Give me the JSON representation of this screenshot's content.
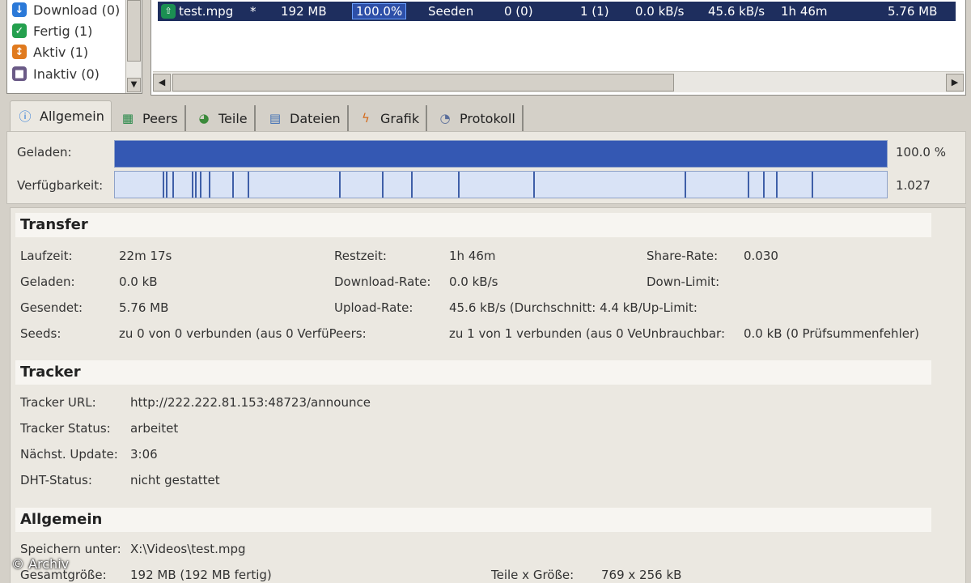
{
  "categories": [
    {
      "label": "Download (0)",
      "color": "#2b79d8",
      "icon": "down-arrow-icon"
    },
    {
      "label": "Fertig (1)",
      "color": "#24a04e",
      "icon": "check-icon"
    },
    {
      "label": "Aktiv (1)",
      "color": "#e07a1e",
      "icon": "activity-icon"
    },
    {
      "label": "Inaktiv (0)",
      "color": "#6a5a86",
      "icon": "pause-icon"
    }
  ],
  "torrent": {
    "name": "test.mpg",
    "star": "*",
    "size": "192 MB",
    "progress": "100.0%",
    "status": "Seeden",
    "seeds": "0 (0)",
    "peers": "1 (1)",
    "down_rate": "0.0 kB/s",
    "up_rate": "45.6 kB/s",
    "eta": "1h 46m",
    "uploaded": "5.76 MB"
  },
  "tabs": [
    {
      "label": "Allgemein",
      "icon": "info-icon"
    },
    {
      "label": "Peers",
      "icon": "peers-icon"
    },
    {
      "label": "Teile",
      "icon": "pieces-icon"
    },
    {
      "label": "Dateien",
      "icon": "files-icon"
    },
    {
      "label": "Grafik",
      "icon": "graph-icon"
    },
    {
      "label": "Protokoll",
      "icon": "log-icon"
    }
  ],
  "bars": {
    "loaded_label": "Geladen:",
    "loaded_value": "100.0 %",
    "loaded_fraction": 1.0,
    "avail_label": "Verfügbarkeit:",
    "avail_value": "1.027",
    "avail_marks": [
      0.062,
      0.066,
      0.074,
      0.1,
      0.104,
      0.11,
      0.122,
      0.152,
      0.172,
      0.29,
      0.346,
      0.384,
      0.444,
      0.542,
      0.738,
      0.82,
      0.84,
      0.856,
      0.902
    ]
  },
  "transfer": {
    "heading": "Transfer",
    "laufzeit_label": "Laufzeit:",
    "laufzeit_value": "22m 17s",
    "restzeit_label": "Restzeit:",
    "restzeit_value": "1h 46m",
    "share_label": "Share-Rate:",
    "share_value": "0.030",
    "geladen_label": "Geladen:",
    "geladen_value": "0.0 kB",
    "dlrate_label": "Download-Rate:",
    "dlrate_value": "0.0 kB/s",
    "downlimit_label": "Down-Limit:",
    "gesendet_label": "Gesendet:",
    "gesendet_value": "5.76 MB",
    "uprate_label": "Upload-Rate:",
    "uprate_value": "45.6 kB/s (Durchschnitt: 4.4 kB/Up-Limit:",
    "seeds_label": "Seeds:",
    "seeds_value": "zu 0 von 0 verbunden (aus 0 VerfüPeers:",
    "peers_value": "zu 1 von 1 verbunden (aus 0 VeUnbrauchbar:",
    "unbrauchbar_value": "0.0 kB (0 Prüfsummenfehler)"
  },
  "tracker": {
    "heading": "Tracker",
    "url_label": "Tracker URL:",
    "url_value": "http://222.222.81.153:48723/announce",
    "status_label": "Tracker Status:",
    "status_value": "arbeitet",
    "update_label": "Nächst. Update:",
    "update_value": "3:06",
    "dht_label": "DHT-Status:",
    "dht_value": "nicht gestattet"
  },
  "general": {
    "heading": "Allgemein",
    "save_label": "Speichern unter:",
    "save_value": "X:\\Videos\\test.mpg",
    "total_label": "Gesamtgröße:",
    "total_value": "192 MB  (192 MB fertig)",
    "pieces_label": "Teile x Größe:",
    "pieces_value": "769 x 256 kB"
  },
  "watermark": "© Archiv"
}
